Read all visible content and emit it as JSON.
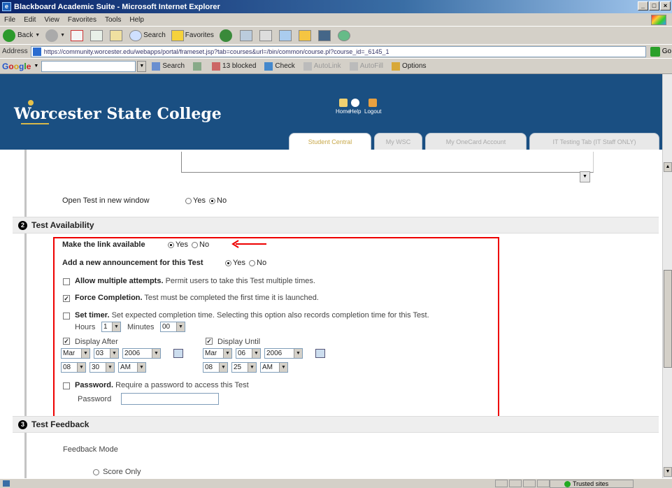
{
  "window": {
    "title": "Blackboard Academic Suite - Microsoft Internet Explorer",
    "btn_min": "_",
    "btn_max": "□",
    "btn_close": "×"
  },
  "menu": [
    "File",
    "Edit",
    "View",
    "Favorites",
    "Tools",
    "Help"
  ],
  "toolbar": {
    "back": "Back",
    "search": "Search",
    "favorites": "Favorites"
  },
  "address": {
    "label": "Address",
    "url": "https://community.worcester.edu/webapps/portal/frameset.jsp?tab=courses&url=/bin/common/course.pl?course_id=_6145_1",
    "go": "Go"
  },
  "google": {
    "logo": [
      "G",
      "o",
      "o",
      "g",
      "l",
      "e"
    ],
    "search": "Search",
    "blocked": "13 blocked",
    "check": "Check",
    "autolink": "AutoLink",
    "autofill": "AutoFill",
    "options": "Options"
  },
  "site": {
    "title": "Worcester State College",
    "home": "Home",
    "help": "Help",
    "logout": "Logout",
    "tabs": [
      "Student Central",
      "My WSC",
      "My OneCard Account",
      "IT Testing Tab (IT Staff ONLY)"
    ]
  },
  "form": {
    "open_new_window": "Open Test in new window",
    "yes": "Yes",
    "no": "No",
    "sec2_num": "2",
    "sec2_title": "Test Availability",
    "make_link": "Make the link available",
    "announce": "Add a new announcement for this Test",
    "multiple_title": "Allow multiple attempts.",
    "multiple_desc": "Permit users to take this Test multiple times.",
    "force_title": "Force Completion.",
    "force_desc": "Test must be completed the first time it is launched.",
    "timer_title": "Set timer.",
    "timer_desc": "Set expected completion time. Selecting this option also records completion time for this Test.",
    "hours_label": "Hours",
    "hours_val": "1",
    "minutes_label": "Minutes",
    "minutes_val": "00",
    "display_after": "Display After",
    "display_until": "Display Until",
    "after_month": "Mar",
    "after_day": "03",
    "after_year": "2006",
    "after_hour": "08",
    "after_min": "30",
    "after_ampm": "AM",
    "until_month": "Mar",
    "until_day": "06",
    "until_year": "2006",
    "until_hour": "08",
    "until_min": "25",
    "until_ampm": "AM",
    "password_title": "Password.",
    "password_desc": "Require a password to access this Test",
    "password_label": "Password",
    "sec3_num": "3",
    "sec3_title": "Test Feedback",
    "feedback_mode": "Feedback Mode",
    "score_only": "Score Only"
  },
  "status": {
    "zone": "Trusted sites"
  },
  "colors": {
    "header_bg": "#1a4f82",
    "highlight": "#e00000"
  }
}
